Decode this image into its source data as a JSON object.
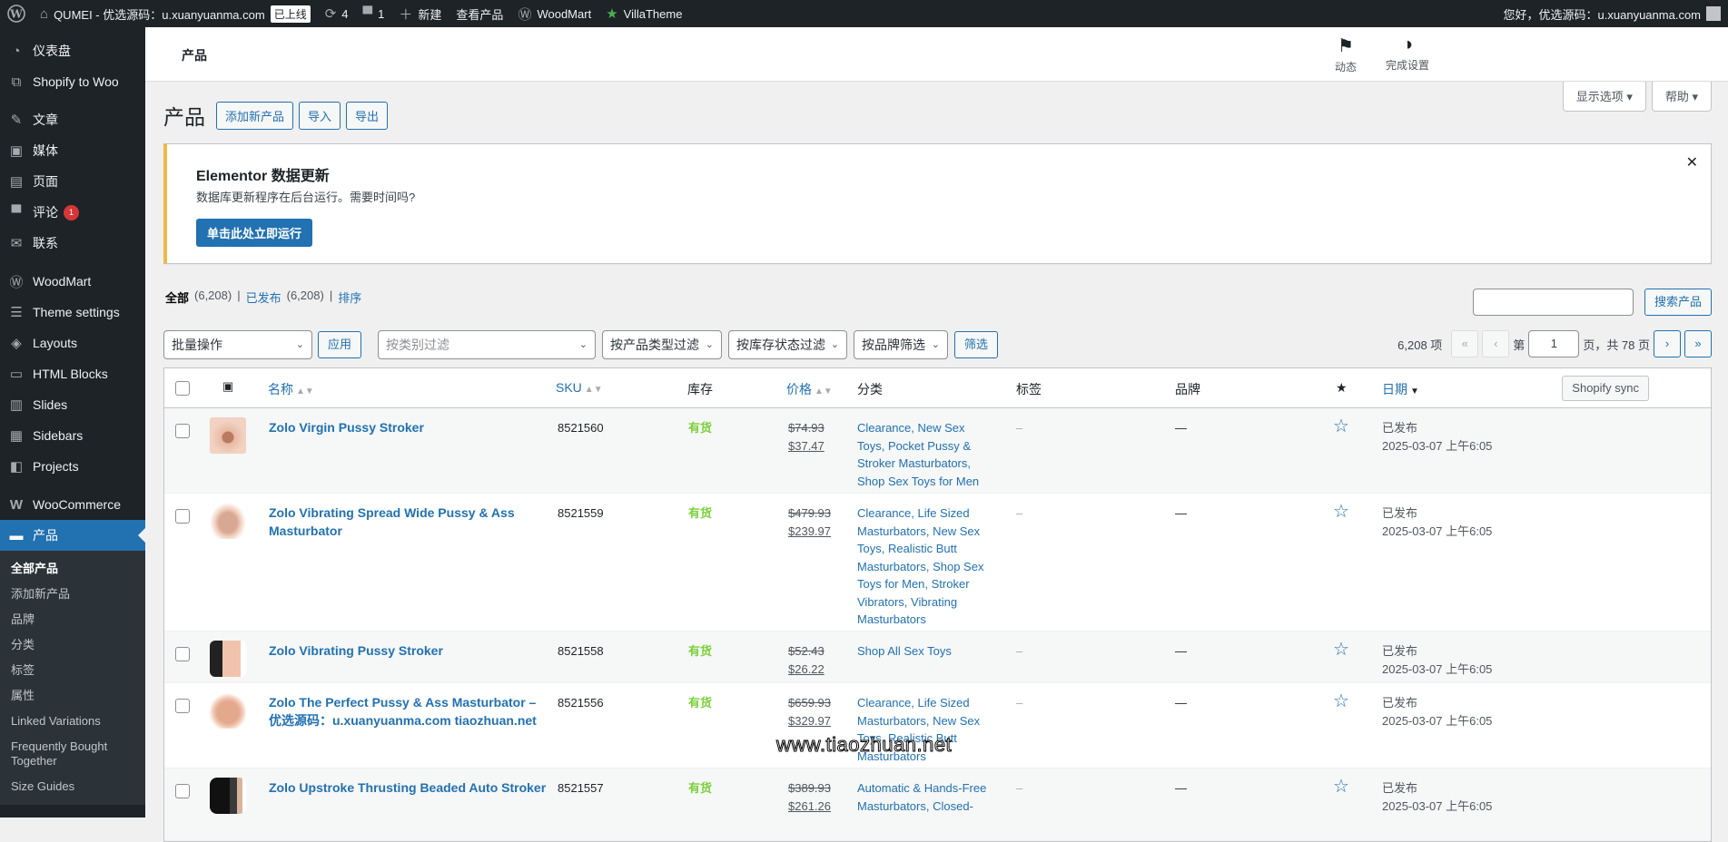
{
  "adminbar": {
    "site_name": "QUMEI - 优选源码：u.xuanyuanma.com",
    "online_badge": "已上线",
    "updates_count": "4",
    "comments_count": "1",
    "new_label": "新建",
    "view_products": "查看产品",
    "woodmart": "WoodMart",
    "villatheme": "VillaTheme",
    "greeting": "您好，优选源码：u.xuanyuanma.com"
  },
  "sidebar": {
    "items": [
      {
        "label": "仪表盘",
        "icon": "dashboard-icon"
      },
      {
        "label": "Shopify to Woo",
        "icon": "shopify-icon"
      },
      {
        "label": "文章",
        "icon": "pin-icon"
      },
      {
        "label": "媒体",
        "icon": "media-icon"
      },
      {
        "label": "页面",
        "icon": "page-icon"
      },
      {
        "label": "评论",
        "icon": "comment-icon",
        "badge": "1"
      },
      {
        "label": "联系",
        "icon": "mail-icon"
      },
      {
        "label": "WoodMart",
        "icon": "woodmart-icon"
      },
      {
        "label": "Theme settings",
        "icon": "sliders-icon"
      },
      {
        "label": "Layouts",
        "icon": "layers-icon"
      },
      {
        "label": "HTML Blocks",
        "icon": "html-icon"
      },
      {
        "label": "Slides",
        "icon": "slides-icon"
      },
      {
        "label": "Sidebars",
        "icon": "sidebar-icon"
      },
      {
        "label": "Projects",
        "icon": "briefcase-icon"
      },
      {
        "label": "WooCommerce",
        "icon": "woo-icon"
      },
      {
        "label": "产品",
        "icon": "archive-icon"
      }
    ],
    "submenu": [
      "全部产品",
      "添加新产品",
      "品牌",
      "分类",
      "标签",
      "属性",
      "Linked Variations",
      "Frequently Bought Together",
      "Size Guides"
    ]
  },
  "topbar": {
    "crumb": "产品",
    "activity": "动态",
    "setup": "完成设置"
  },
  "screen_options": "显示选项 ▾",
  "help": "帮助 ▾",
  "page": {
    "title": "产品",
    "add_new": "添加新产品",
    "import": "导入",
    "export": "导出"
  },
  "notice": {
    "title": "Elementor 数据更新",
    "text": "数据库更新程序在后台运行。需要时间吗?",
    "button": "单击此处立即运行"
  },
  "views": {
    "all": "全部",
    "all_count": "(6,208)",
    "published": "已发布",
    "published_count": "(6,208)",
    "sort": "排序",
    "sep": "|"
  },
  "search": {
    "value": "",
    "button": "搜索产品"
  },
  "filters": {
    "bulk": "批量操作",
    "apply": "应用",
    "category_placeholder": "按类别过滤",
    "type": "按产品类型过滤",
    "stock": "按库存状态过滤",
    "brand": "按品牌筛选",
    "filter_btn": "筛选"
  },
  "pagination": {
    "items": "6,208 项",
    "first": "«",
    "prev": "‹",
    "page_label": "第",
    "current": "1",
    "total": "页，共 78 页",
    "next": "›",
    "last": "»"
  },
  "table": {
    "headers": {
      "name": "名称",
      "sku": "SKU",
      "stock": "库存",
      "price": "价格",
      "categories": "分类",
      "tags": "标签",
      "brand": "品牌",
      "date": "日期",
      "sync": "Shopify sync"
    },
    "rows": [
      {
        "name": "Zolo Virgin Pussy Stroker",
        "sku": "8521560",
        "stock": "有货",
        "old_price": "$74.93",
        "price": "$37.47",
        "categories": "Clearance, New Sex Toys, Pocket Pussy & Stroker Masturbators, Shop Sex Toys for Men",
        "tags": "–",
        "brand": "—",
        "status": "已发布",
        "date": "2025-03-07 上午6:05"
      },
      {
        "name": "Zolo Vibrating Spread Wide Pussy & Ass Masturbator",
        "sku": "8521559",
        "stock": "有货",
        "old_price": "$479.93",
        "price": "$239.97",
        "categories": "Clearance, Life Sized Masturbators, New Sex Toys, Realistic Butt Masturbators, Shop Sex Toys for Men, Stroker Vibrators, Vibrating Masturbators",
        "tags": "–",
        "brand": "—",
        "status": "已发布",
        "date": "2025-03-07 上午6:05"
      },
      {
        "name": "Zolo Vibrating Pussy Stroker",
        "sku": "8521558",
        "stock": "有货",
        "old_price": "$52.43",
        "price": "$26.22",
        "categories": "Shop All Sex Toys",
        "tags": "–",
        "brand": "—",
        "status": "已发布",
        "date": "2025-03-07 上午6:05"
      },
      {
        "name": "Zolo The Perfect Pussy & Ass Masturbator – 优选源码：u.xuanyuanma.com tiaozhuan.net",
        "sku": "8521556",
        "stock": "有货",
        "old_price": "$659.93",
        "price": "$329.97",
        "categories": "Clearance, Life Sized Masturbators, New Sex Toys, Realistic Butt Masturbators",
        "tags": "–",
        "brand": "—",
        "status": "已发布",
        "date": "2025-03-07 上午6:05"
      },
      {
        "name": "Zolo Upstroke Thrusting Beaded Auto Stroker",
        "sku": "8521557",
        "stock": "有货",
        "old_price": "$389.93",
        "price": "$261.26",
        "categories": "Automatic & Hands-Free Masturbators, Closed-",
        "tags": "–",
        "brand": "—",
        "status": "已发布",
        "date": "2025-03-07 上午6:05"
      }
    ]
  },
  "watermark": "www.tiaozhuan.net",
  "colors": {
    "accent": "#2271b1",
    "admin_dark": "#1d2327",
    "in_stock": "#7ad03a",
    "notice_border": "#f0b849",
    "badge_red": "#d63638"
  }
}
